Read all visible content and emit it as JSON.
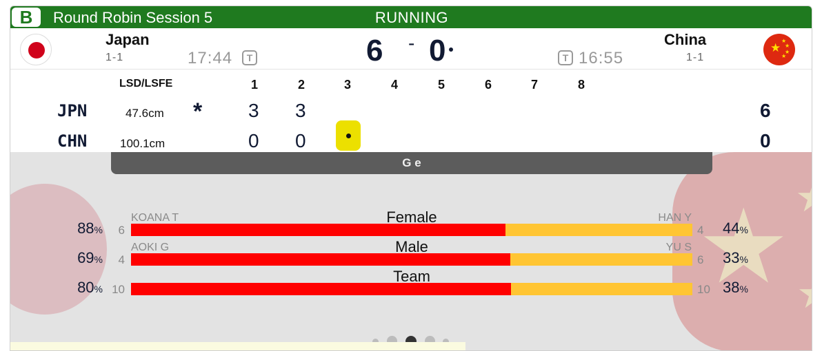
{
  "header": {
    "badge": "B",
    "session": "Round Robin Session 5",
    "status": "RUNNING"
  },
  "teams": {
    "left": {
      "name": "Japan",
      "record": "1-1",
      "clock": "17:44",
      "timer_icon": "T",
      "score": "6",
      "code": "JPN",
      "lsd": "47.6cm",
      "hammer_mark": "*",
      "ends": [
        "3",
        "3"
      ],
      "total": "6"
    },
    "right": {
      "name": "China",
      "record": "1-1",
      "clock": "16:55",
      "timer_icon": "T",
      "score": "0",
      "code": "CHN",
      "lsd": "100.1cm",
      "ends": [
        "0",
        "0"
      ],
      "total": "0"
    },
    "score_separator": "-"
  },
  "endsTable": {
    "lsd_header": "LSD/LSFE",
    "end_numbers": [
      "1",
      "2",
      "3",
      "4",
      "5",
      "6",
      "7",
      "8"
    ],
    "current_end": 3
  },
  "game_band": "G    e",
  "stats": [
    {
      "label": "Female",
      "left_player": "KOANA T",
      "right_player": "HAN Y",
      "left_pct": "88",
      "left_count": "6",
      "right_count": "4",
      "right_pct": "44",
      "fill": 0.667
    },
    {
      "label": "Male",
      "left_player": "AOKI G",
      "right_player": "YU S",
      "left_pct": "69",
      "left_count": "4",
      "right_count": "6",
      "right_pct": "33",
      "fill": 0.676
    },
    {
      "label": "Team",
      "left_player": "",
      "right_player": "",
      "left_pct": "80",
      "left_count": "10",
      "right_count": "10",
      "right_pct": "38",
      "fill": 0.677
    }
  ],
  "percent_sign": "%",
  "pager": {
    "pages": 5,
    "active": 2
  },
  "colors": {
    "header_green": "#1f7a1f",
    "team_left": "#ff0000",
    "team_right": "#ffc533",
    "current_end": "#ece000"
  },
  "icons": [
    "timer-icon",
    "japan-flag-icon",
    "china-flag-icon",
    "hammer-icon"
  ]
}
